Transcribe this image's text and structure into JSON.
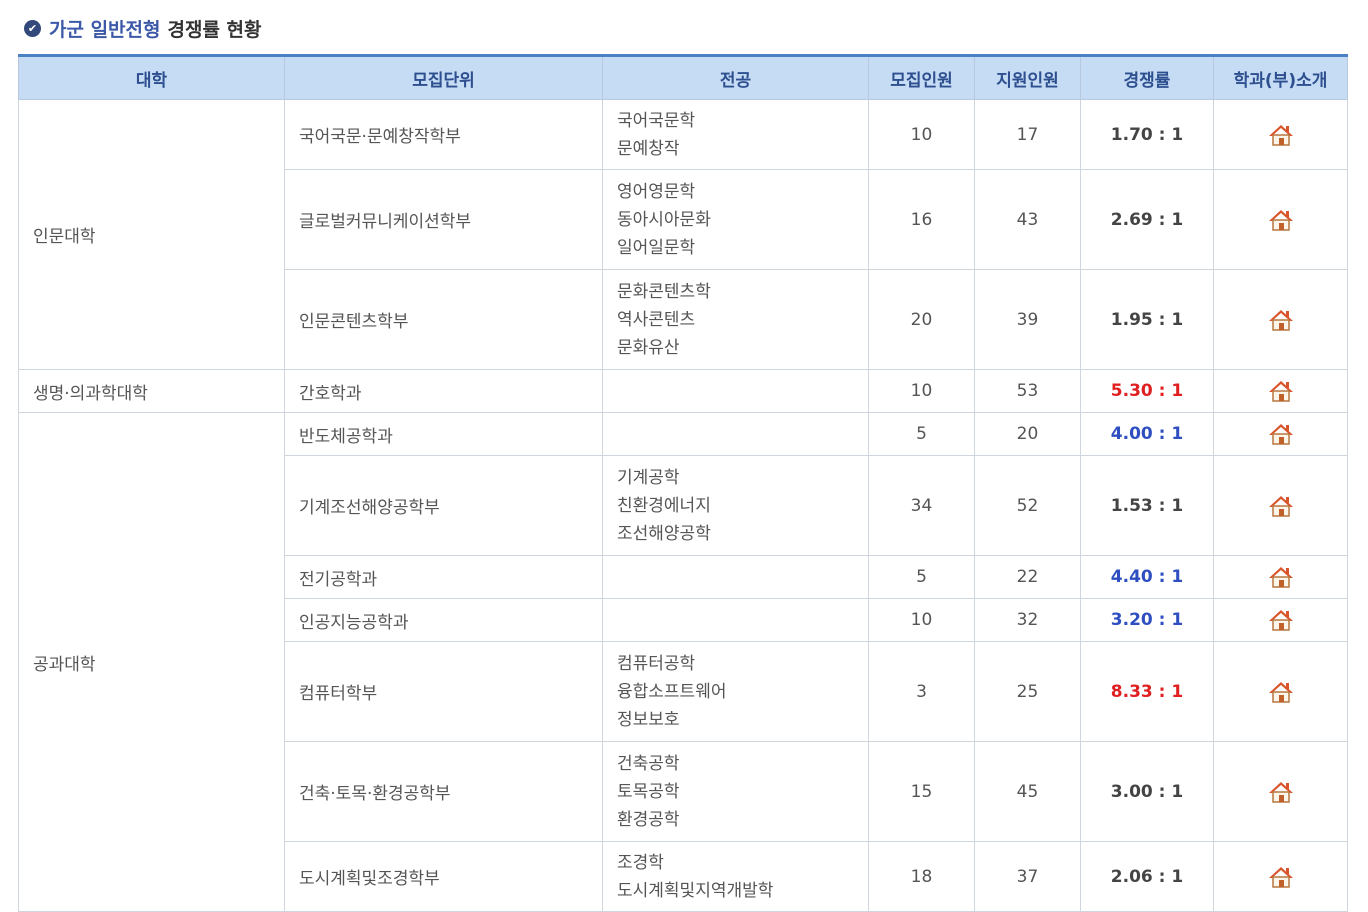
{
  "title": {
    "part1": "가군 일반전형",
    "part2": "경쟁률 현황"
  },
  "headers": [
    "대학",
    "모집단위",
    "전공",
    "모집인원",
    "지원인원",
    "경쟁률",
    "학과(부)소개"
  ],
  "colors": {
    "accent": "#3c59a8",
    "header_bg": "#c6dcf5",
    "red": "#e02020",
    "blue": "#2f4fc0",
    "normal": "#444444"
  },
  "groups": [
    {
      "college": "인문대학",
      "rows": [
        {
          "unit": "국어국문·문예창작학부",
          "majors": [
            "국어국문학",
            "문예창작"
          ],
          "quota": "10",
          "applicants": "17",
          "ratio": "1.70 : 1",
          "ratio_color": "normal"
        },
        {
          "unit": "글로벌커뮤니케이션학부",
          "majors": [
            "영어영문학",
            "동아시아문화",
            "일어일문학"
          ],
          "quota": "16",
          "applicants": "43",
          "ratio": "2.69 : 1",
          "ratio_color": "normal"
        },
        {
          "unit": "인문콘텐츠학부",
          "majors": [
            "문화콘텐츠학",
            "역사콘텐츠",
            "문화유산"
          ],
          "quota": "20",
          "applicants": "39",
          "ratio": "1.95 : 1",
          "ratio_color": "normal"
        }
      ]
    },
    {
      "college": "생명·의과학대학",
      "rows": [
        {
          "unit": "간호학과",
          "majors": [],
          "quota": "10",
          "applicants": "53",
          "ratio": "5.30 : 1",
          "ratio_color": "red"
        }
      ]
    },
    {
      "college": "공과대학",
      "rows": [
        {
          "unit": "반도체공학과",
          "majors": [],
          "quota": "5",
          "applicants": "20",
          "ratio": "4.00 : 1",
          "ratio_color": "blue"
        },
        {
          "unit": "기계조선해양공학부",
          "majors": [
            "기계공학",
            "친환경에너지",
            "조선해양공학"
          ],
          "quota": "34",
          "applicants": "52",
          "ratio": "1.53 : 1",
          "ratio_color": "normal"
        },
        {
          "unit": "전기공학과",
          "majors": [],
          "quota": "5",
          "applicants": "22",
          "ratio": "4.40 : 1",
          "ratio_color": "blue"
        },
        {
          "unit": "인공지능공학과",
          "majors": [],
          "quota": "10",
          "applicants": "32",
          "ratio": "3.20 : 1",
          "ratio_color": "blue"
        },
        {
          "unit": "컴퓨터학부",
          "majors": [
            "컴퓨터공학",
            "융합소프트웨어",
            "정보보호"
          ],
          "quota": "3",
          "applicants": "25",
          "ratio": "8.33 : 1",
          "ratio_color": "red"
        },
        {
          "unit": "건축·토목·환경공학부",
          "majors": [
            "건축공학",
            "토목공학",
            "환경공학"
          ],
          "quota": "15",
          "applicants": "45",
          "ratio": "3.00 : 1",
          "ratio_color": "normal"
        },
        {
          "unit": "도시계획및조경학부",
          "majors": [
            "조경학",
            "도시계획및지역개발학"
          ],
          "quota": "18",
          "applicants": "37",
          "ratio": "2.06 : 1",
          "ratio_color": "normal"
        }
      ]
    }
  ],
  "icons": {
    "check": "check-circle-icon",
    "home": "home-icon"
  }
}
